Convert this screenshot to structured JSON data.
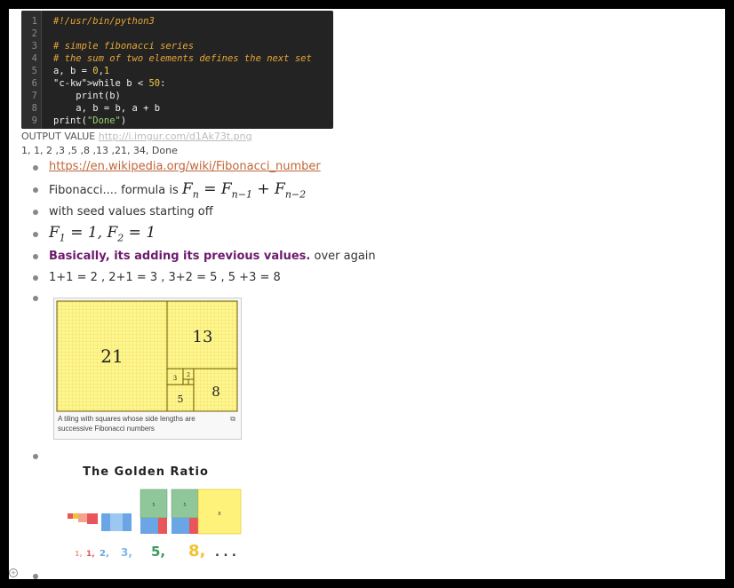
{
  "code": {
    "lines": [
      {
        "n": "1",
        "text": "#!/usr/bin/python3"
      },
      {
        "n": "2",
        "text": ""
      },
      {
        "n": "3",
        "text": "# simple fibonacci series"
      },
      {
        "n": "4",
        "text": "# the sum of two elements defines the next set"
      },
      {
        "n": "5",
        "text": "a, b = 0,1"
      },
      {
        "n": "6",
        "text": "while b < 50:"
      },
      {
        "n": "7",
        "text": "    print(b)"
      },
      {
        "n": "8",
        "text": "    a, b = b, a + b"
      },
      {
        "n": "9",
        "text": "print(\"Done\")"
      }
    ]
  },
  "output": {
    "label": "OUTPUT VALUE",
    "link": "http://i.imgur.com/d1Ak73t.png",
    "values": "1, 1, 2 ,3 ,5 ,8 ,13 ,21, 34, Done"
  },
  "list": {
    "wiki_link": "https://en.wikipedia.org/wiki/Fibonacci_number",
    "formula_prefix": "Fibonacci.... formula is ",
    "formula": {
      "lhs": "F",
      "lhs_sub": "n",
      "eq": " = ",
      "a": "F",
      "a_sub": "n−1",
      "plus": " + ",
      "b": "F",
      "b_sub": "n−2"
    },
    "seed_text": "with seed values starting off",
    "seed_formula": {
      "p1": "F",
      "s1": "1",
      "m1": " = 1, ",
      "p2": "F",
      "s2": "2",
      "m2": " = 1"
    },
    "adding_bold": "Basically, its adding its previous values.",
    "adding_rest": " over again",
    "sums": "1+1 = 2 ,  2+1 = 3 ,  3+2 = 5 ,  5 +3 = 8"
  },
  "tiling": {
    "labels": [
      "21",
      "13",
      "8",
      "5",
      "3",
      "2"
    ],
    "caption": "A tiling with squares whose side lengths are successive Fibonacci numbers"
  },
  "golden": {
    "title": "The Golden Ratio",
    "sequence": [
      {
        "text": "1,",
        "color": "#f4a38c"
      },
      {
        "text": "1,",
        "color": "#e8555a"
      },
      {
        "text": "2,",
        "color": "#6aa5e6"
      },
      {
        "text": "3,",
        "color": "#7fb7ea"
      },
      {
        "text": "5,",
        "color": "#3d9a5e"
      },
      {
        "text": "8,",
        "color": "#f1c232"
      },
      {
        "text": ". . .",
        "color": "#333333"
      }
    ],
    "box_labels": [
      "5",
      "5",
      "8"
    ]
  },
  "colors": {
    "link": "#c0653a",
    "bold_purple": "#6c1a6d",
    "tile_fill": "#fff690",
    "tile_stroke": "#c8a800"
  }
}
